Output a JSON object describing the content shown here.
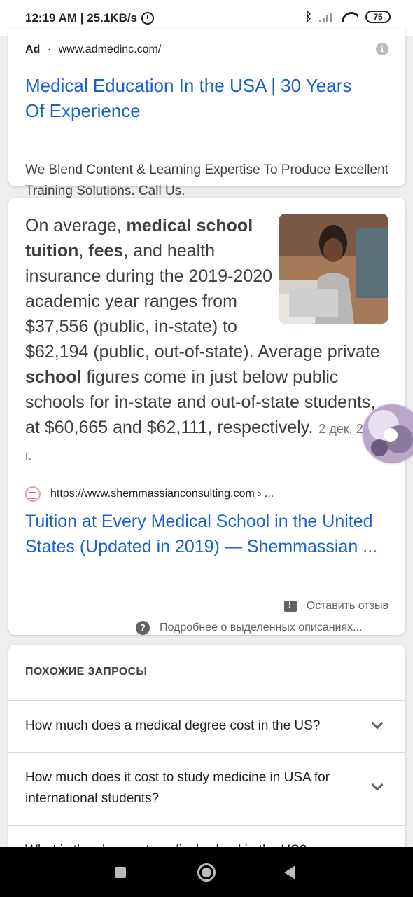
{
  "status_bar": {
    "time_speed": "12:19 AM | 25.1KB/s",
    "battery": "75",
    "icons": [
      "alarm-icon",
      "bluetooth-icon",
      "signal-icon",
      "wifi-icon",
      "battery-icon"
    ]
  },
  "ad": {
    "label": "Ad",
    "separator": "·",
    "url": "www.admedinc.com/",
    "title": "Medical Education In the USA | 30 Years Of Experience",
    "description": "We Blend Content & Learning Expertise To Produce Excellent Training Solutions. Call Us."
  },
  "snippet": {
    "text_parts": [
      "On average, ",
      "medical school tuition",
      ", ",
      "fees",
      ", and health insurance during the 2019-2020 academic year ranges from $37,556 (public, in-state) to $62,194 (public, out-of-state). Average private ",
      "school",
      " figures come in just below public schools for in-state and out-of-state students, at $60,665 and $62,111, respectively."
    ],
    "date": "2 дек. 2018 г.",
    "source_url": "https://www.shemmassianconsulting.com › ...",
    "result_title": "Tuition at Every Medical School in the United States (Updated in 2019) — Shemmassian ...",
    "feedback": "Оставить отзыв",
    "about": "Подробнее о выделенных описаниях..."
  },
  "related": {
    "heading": "ПОХОЖИЕ ЗАПРОСЫ",
    "items": [
      "How much does a medical degree cost in the US?",
      "How much does it cost to study medicine in USA for international students?",
      "What is the cheapest medical school in the US?"
    ]
  },
  "colors": {
    "link": "#1a62c9",
    "text": "#3c4043",
    "background": "#eeeeee"
  }
}
